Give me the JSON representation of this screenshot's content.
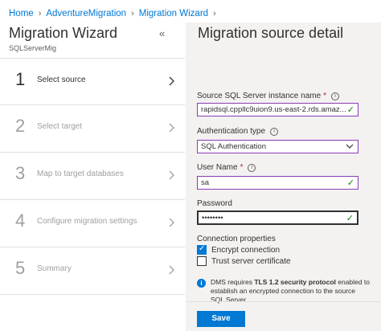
{
  "breadcrumb": [
    "Home",
    "AdventureMigration",
    "Migration Wizard"
  ],
  "left": {
    "title": "Migration Wizard",
    "subtitle": "SQLServerMig",
    "collapse_icon": "«",
    "steps": [
      {
        "num": "1",
        "label": "Select source",
        "active": true
      },
      {
        "num": "2",
        "label": "Select target",
        "active": false
      },
      {
        "num": "3",
        "label": "Map to target databases",
        "active": false
      },
      {
        "num": "4",
        "label": "Configure migration settings",
        "active": false
      },
      {
        "num": "5",
        "label": "Summary",
        "active": false
      }
    ]
  },
  "right": {
    "title": "Migration source detail",
    "instance": {
      "label": "Source SQL Server instance name",
      "required": "*",
      "value": "rapidsql.cppllc9uion9.us-east-2.rds.amaz..."
    },
    "auth": {
      "label": "Authentication type",
      "value": "SQL Authentication"
    },
    "user": {
      "label": "User Name",
      "required": "*",
      "value": "sa"
    },
    "password": {
      "label": "Password",
      "value": "••••••••"
    },
    "connection": {
      "label": "Connection properties",
      "encrypt": {
        "label": "Encrypt connection",
        "checked": true
      },
      "trust": {
        "label": "Trust server certificate",
        "checked": false
      }
    },
    "note": {
      "prefix": "DMS requires ",
      "bold": "TLS 1.2 security protocol",
      "suffix": " enabled to establish an encrypted connection to the source SQL Server."
    },
    "save_label": "Save"
  },
  "colors": {
    "accent": "#0078d4",
    "valid_border": "#8a3ab9",
    "success": "#107c10"
  }
}
